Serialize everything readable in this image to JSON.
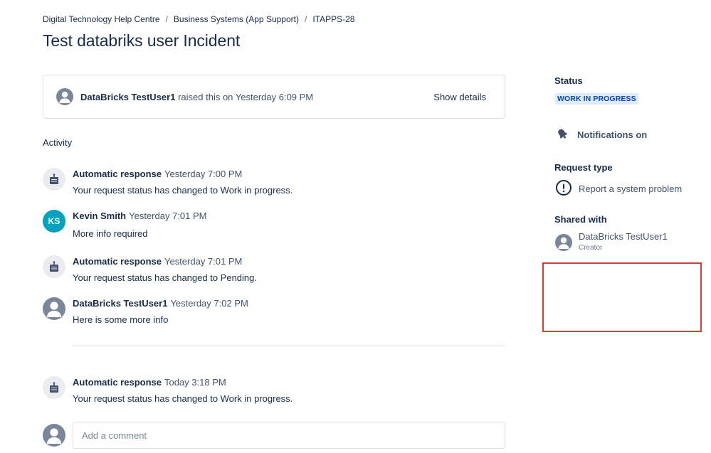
{
  "breadcrumb": [
    "Digital Technology Help Centre",
    "Business Systems (App Support)",
    "ITAPPS-28"
  ],
  "breadcrumb_separator": "/",
  "page_title": "Test databriks user Incident",
  "raised": {
    "name": "DataBricks TestUser1",
    "text": "raised this on Yesterday 6:09 PM",
    "show_details_label": "Show details"
  },
  "activity": {
    "heading": "Activity",
    "items": [
      {
        "author": "Automatic response",
        "time": "Yesterday 7:00 PM",
        "message": "Your request status has changed to Work in progress.",
        "avatar": "robot-icon"
      },
      {
        "author": "Kevin Smith",
        "time": "Yesterday 7:01 PM",
        "message": "More info required",
        "avatar": "KS"
      },
      {
        "author": "Automatic response",
        "time": "Yesterday 7:01 PM",
        "message": "Your request status has changed to Pending.",
        "avatar": "robot-icon"
      },
      {
        "author": "DataBricks TestUser1",
        "time": "Yesterday 7:02 PM",
        "message": "Here is some more info",
        "avatar": "user-icon"
      },
      {
        "author": "Automatic response",
        "time": "Today 3:18 PM",
        "message": "Your request status has changed to Work in progress.",
        "avatar": "robot-icon"
      }
    ]
  },
  "comment": {
    "placeholder": "Add a comment"
  },
  "sidebar": {
    "status_label": "Status",
    "status_value": "WORK IN PROGRESS",
    "notifications_label": "Notifications on",
    "request_type_label": "Request type",
    "request_type_value": "Report a system problem",
    "shared_with_label": "Shared with",
    "shared_user_name": "DataBricks TestUser1",
    "shared_user_role": "Creator"
  },
  "colors": {
    "status_bg": "#deebff",
    "status_text": "#0747a6",
    "ks_avatar": "#00a3bf",
    "highlight": "#e53935"
  }
}
